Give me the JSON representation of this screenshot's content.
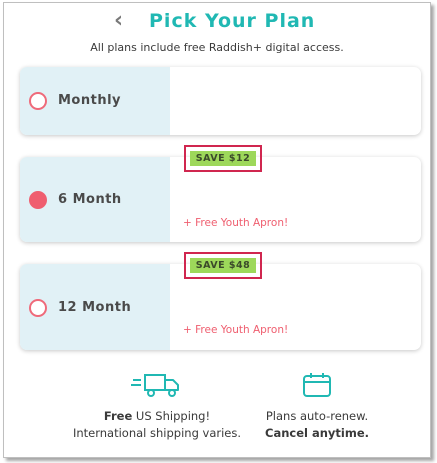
{
  "header": {
    "back_icon": "chevron-left-icon",
    "title": "Pick Your Plan",
    "subtitle": "All plans include free Raddish+ digital access."
  },
  "plans": [
    {
      "label": "Monthly",
      "selected": false,
      "save_badge": "",
      "bonus": ""
    },
    {
      "label": "6 Month",
      "selected": true,
      "save_badge": "SAVE $12",
      "bonus": "+ Free Youth Apron!"
    },
    {
      "label": "12 Month",
      "selected": false,
      "save_badge": "SAVE $48",
      "bonus": "+ Free Youth Apron!"
    }
  ],
  "features": {
    "shipping": {
      "icon": "delivery-truck-icon",
      "line1_bold": "Free",
      "line1_rest": " US Shipping!",
      "line2": "International shipping varies."
    },
    "renew": {
      "icon": "calendar-icon",
      "line1": "Plans auto-renew.",
      "line2_bold": "Cancel anytime."
    }
  },
  "colors": {
    "title_teal": "#20b8b3",
    "radio_pink": "#ef5e6f",
    "badge_green": "#9dd85a",
    "highlight_red": "#d0264f",
    "left_panel": "#e1f1f6"
  }
}
